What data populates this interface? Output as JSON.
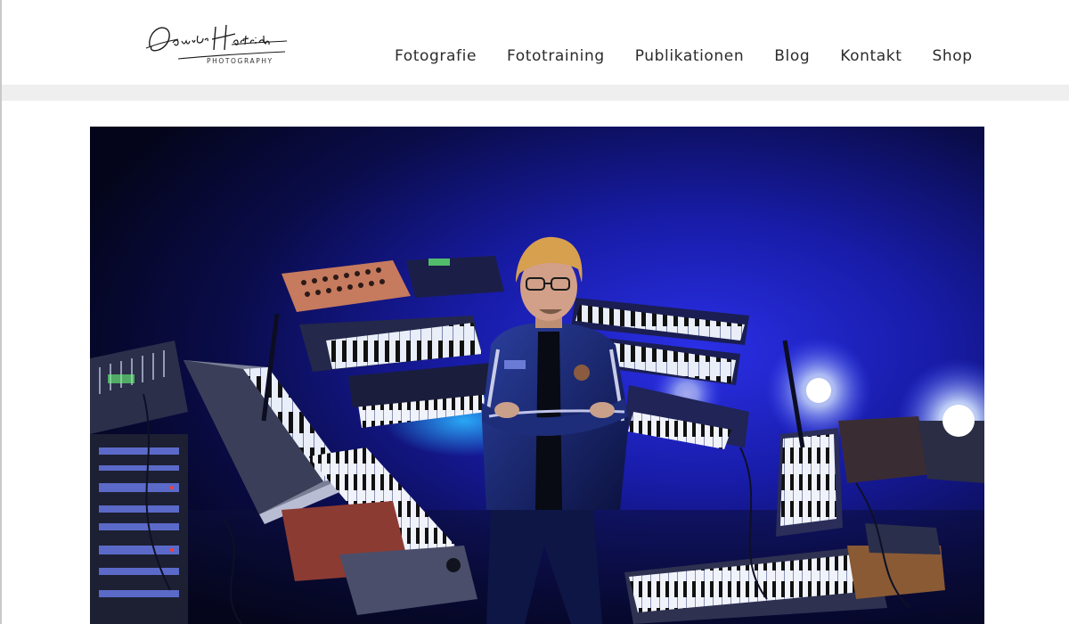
{
  "logo": {
    "script": "Daniel Hertrich",
    "subtitle": "PHOTOGRAPHY"
  },
  "nav": {
    "items": [
      {
        "label": "Fotografie"
      },
      {
        "label": "Fototraining"
      },
      {
        "label": "Publikationen"
      },
      {
        "label": "Blog"
      },
      {
        "label": "Kontakt"
      },
      {
        "label": "Shop"
      }
    ]
  },
  "colors": {
    "nav_text": "#2b2b2b",
    "band": "#efefef",
    "stage_blue": "#2a33ff",
    "stage_dark": "#05061d"
  },
  "hero": {
    "subject": "musician-with-synthesizers-photo"
  }
}
